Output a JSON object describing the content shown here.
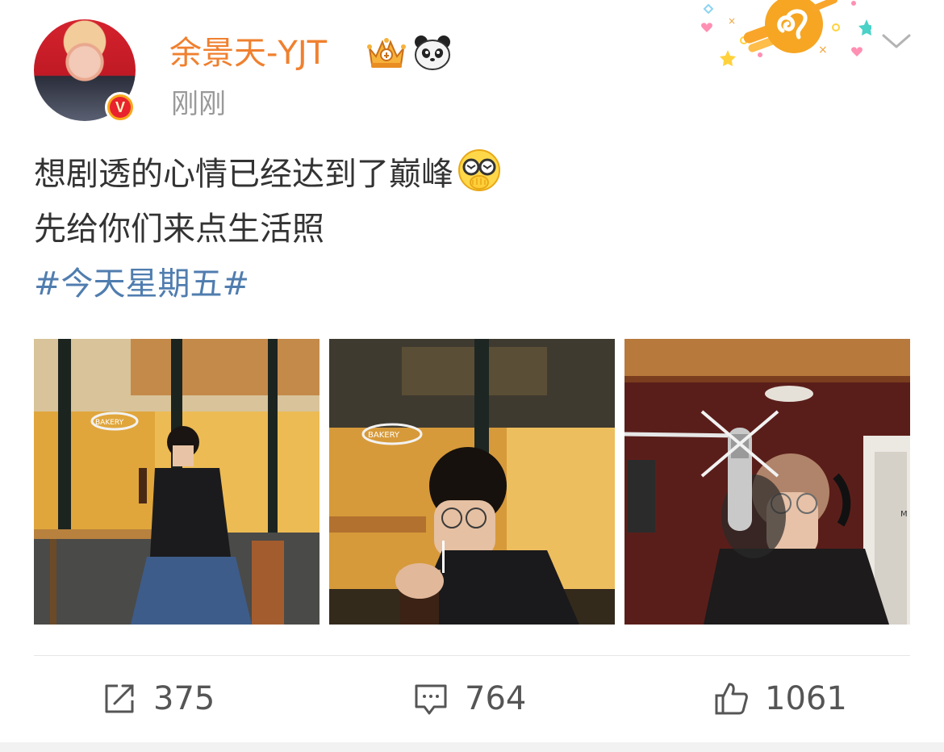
{
  "post": {
    "author": {
      "name": "余景天-YJT",
      "verified_badge": "V",
      "badges": [
        "crown-badge-icon",
        "panda-icon"
      ]
    },
    "timestamp": "刚刚",
    "text_lines": [
      "想剧透的心情已经达到了巅峰",
      "先给你们来点生活照"
    ],
    "emoji": "glasses-hand-over-mouth-emoji",
    "hashtag": "#今天星期五#",
    "images": [
      {
        "scene": "cafe-seated-with-iced-drink",
        "sign_text": "BAKERY"
      },
      {
        "scene": "cafe-drinking-with-straw",
        "sign_text": "BAKERY"
      },
      {
        "scene": "recording-studio-microphone",
        "sign_text": "M"
      }
    ],
    "actions": {
      "repost": {
        "icon": "share-icon",
        "count": "375"
      },
      "comment": {
        "icon": "comment-icon",
        "count": "764"
      },
      "like": {
        "icon": "thumbs-up-icon",
        "count": "1061"
      }
    }
  },
  "colors": {
    "username": "#f0802f",
    "hashtag": "#507daf",
    "timestamp": "#999999",
    "text": "#333333"
  }
}
